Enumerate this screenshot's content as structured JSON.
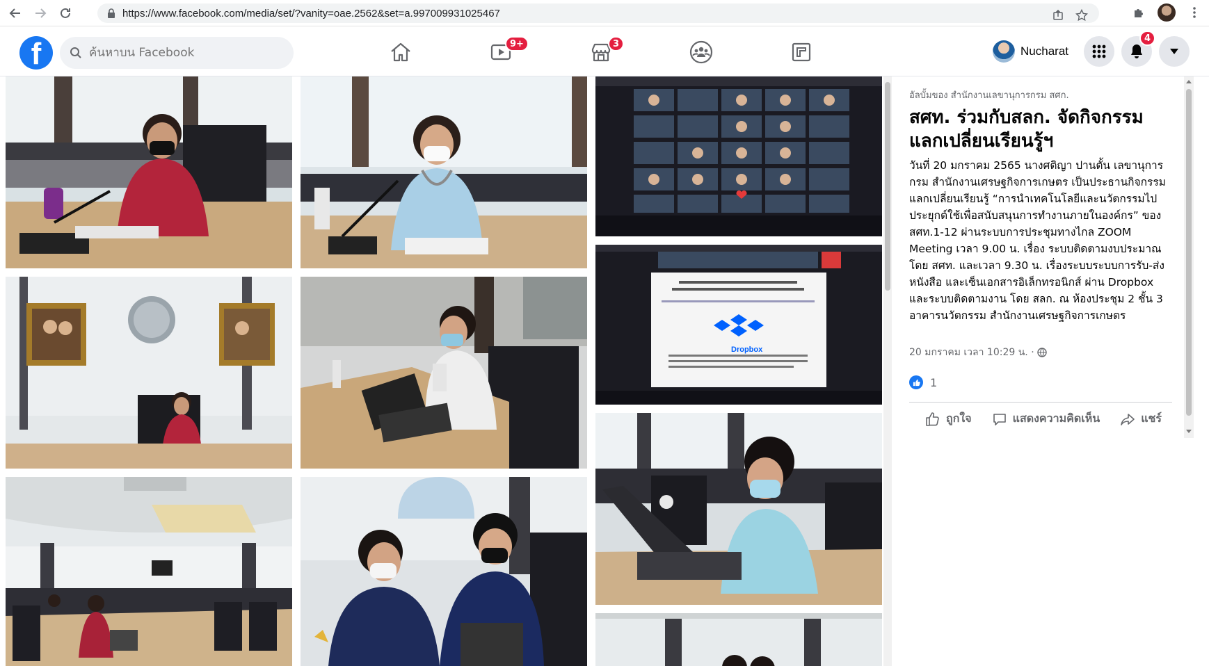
{
  "browser": {
    "url": "https://www.facebook.com/media/set/?vanity=oae.2562&set=a.997009931025467"
  },
  "header": {
    "search_placeholder": "ค้นหาบน Facebook",
    "watch_badge": "9+",
    "marketplace_badge": "3",
    "notification_badge": "4",
    "profile_name": "Nucharat"
  },
  "post": {
    "album_owner": "อัลบั้มของ สำนักงานเลขานุการกรม สศก.",
    "title": "สศท. ร่วมกับสลก. จัดกิจกรรมแลกเปลี่ยนเรียนรู้ฯ",
    "body": "วันที่ 20 มกราคม 2565 นางศติญา ปานตั้น เลขานุการกรม สำนักงานเศรษฐกิจการเกษตร เป็นประธานกิจกรรมแลกเปลี่ยนเรียนรู้ “การนำเทคโนโลยีและนวัตกรรมไปประยุกต์ใช้เพื่อสนับสนุนการทำงานภายในองค์กร” ของสศท.1-12 ผ่านระบบการประชุมทางไกล ZOOM Meeting เวลา 9.00 น. เรื่อง ระบบติดตามงบประมาณ โดย สศท. และเวลา 9.30 น. เรื่องระบบระบบการรับ-ส่งหนังสือ และเซ็นเอกสารอิเล็กทรอนิกส์ ผ่าน Dropbox และระบบติดตามงาน โดย สลก. ณ ห้องประชุม 2 ชั้น 3 อาคารนวัตกรรม สำนักงานเศรษฐกิจการเกษตร",
    "timestamp": "20 มกราคม เวลา 10:29 น. ·",
    "reaction_count": "1",
    "like_label": "ถูกใจ",
    "comment_label": "แสดงความคิดเห็น",
    "share_label": "แชร์"
  },
  "photos": [
    {
      "id": "photo-1",
      "scene": "woman-red-mic"
    },
    {
      "id": "photo-2",
      "scene": "woman-blue-desk"
    },
    {
      "id": "photo-3",
      "scene": "zoom-gallery"
    },
    {
      "id": "photo-4",
      "scene": "room-portraits"
    },
    {
      "id": "photo-5",
      "scene": "woman-laptop"
    },
    {
      "id": "photo-6",
      "scene": "zoom-dropbox"
    },
    {
      "id": "photo-7",
      "scene": "conference-room"
    },
    {
      "id": "photo-8",
      "scene": "two-women-laptop"
    },
    {
      "id": "photo-9",
      "scene": "woman-laptop-mask"
    },
    {
      "id": "photo-10",
      "scene": "room-partial"
    }
  ],
  "dropbox_slide": {
    "brand": "Dropbox"
  },
  "colors": {
    "fb_blue": "#1877f2",
    "badge_red": "#e41e3f",
    "text_secondary": "#65676b"
  }
}
